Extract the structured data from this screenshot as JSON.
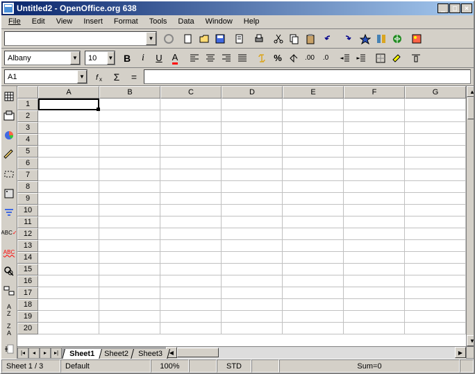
{
  "title": "Untitled2  -  OpenOffice.org 638",
  "menu": [
    "File",
    "Edit",
    "View",
    "Insert",
    "Format",
    "Tools",
    "Data",
    "Window",
    "Help"
  ],
  "font": {
    "name": "Albany",
    "size": "10"
  },
  "cellref": "A1",
  "formula_symbols": {
    "fx": "=",
    "sigma": "Σ",
    "eq": "="
  },
  "columns": [
    "A",
    "B",
    "C",
    "D",
    "E",
    "F",
    "G"
  ],
  "rows": [
    "1",
    "2",
    "3",
    "4",
    "5",
    "6",
    "7",
    "8",
    "9",
    "10",
    "11",
    "12",
    "13",
    "14",
    "15",
    "16",
    "17",
    "18",
    "19",
    "20"
  ],
  "tabs": [
    "Sheet1",
    "Sheet2",
    "Sheet3"
  ],
  "status": {
    "sheet": "Sheet 1 / 3",
    "style": "Default",
    "zoom": "100%",
    "mode": "STD",
    "sum": "Sum=0"
  }
}
